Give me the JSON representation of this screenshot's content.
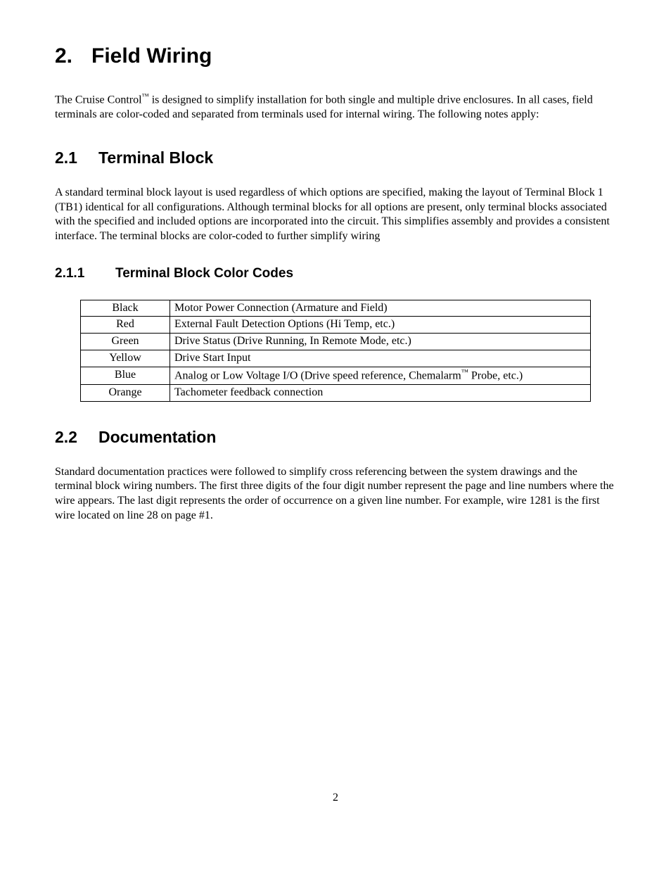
{
  "h1_num": "2.",
  "h1_text": "Field Wiring",
  "intro_before_tm": "The Cruise Control",
  "intro_tm": "™",
  "intro_after_tm": " is designed to simplify installation for both single and multiple drive enclosures.  In all cases, field terminals are color-coded and separated from terminals used for internal wiring.  The following notes apply:",
  "h2a_num": "2.1",
  "h2a_text": "Terminal Block",
  "para21": "A standard terminal block layout is used regardless of which options are specified, making the layout of Terminal Block 1 (TB1) identical for all configurations.  Although terminal blocks for all options are present, only terminal blocks associated with the specified and included options are incorporated into the circuit.  This simplifies assembly and provides a consistent interface. The terminal blocks are color-coded to further simplify wiring",
  "h3_num": "2.1.1",
  "h3_text": "Terminal Block Color Codes",
  "rows": {
    "0": {
      "color": "Black",
      "desc": "Motor Power Connection (Armature and Field)"
    },
    "1": {
      "color": "Red",
      "desc": "External Fault Detection Options (Hi Temp, etc.)"
    },
    "2": {
      "color": "Green",
      "desc": "Drive Status (Drive Running, In Remote Mode, etc.)"
    },
    "3": {
      "color": "Yellow",
      "desc": "Drive Start Input"
    },
    "4": {
      "color": "Blue",
      "desc_before": "Analog or Low Voltage I/O  (Drive speed reference, Chemalarm",
      "tm": "™",
      "desc_after": " Probe, etc.)"
    },
    "5": {
      "color": "Orange",
      "desc": "Tachometer feedback connection"
    }
  },
  "h2b_num": "2.2",
  "h2b_text": "Documentation",
  "para22": "Standard documentation practices were followed to simplify cross referencing between the system drawings and the terminal block wiring numbers.  The first three digits of the four digit number represent the page and line numbers where the wire appears.  The last digit represents the order of occurrence on a given line number.  For example, wire 1281 is the first wire located on line 28 on page #1.",
  "page_number": "2"
}
